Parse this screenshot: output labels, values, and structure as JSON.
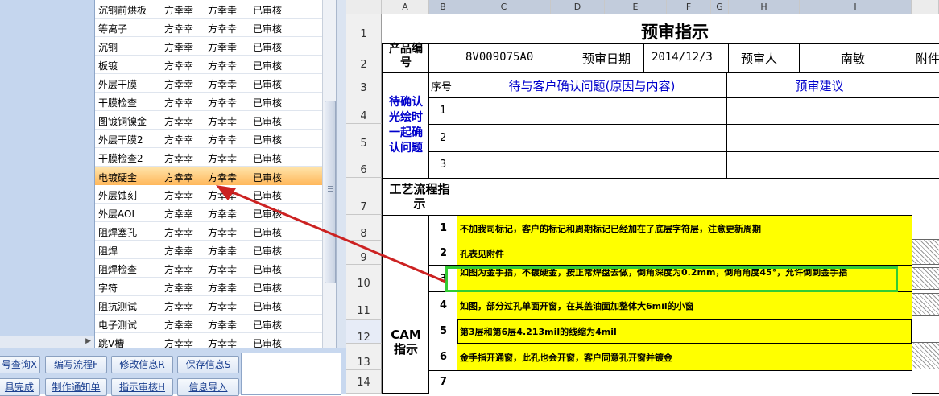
{
  "list": {
    "rows": [
      [
        "沉铜前烘板",
        "方幸幸",
        "方幸幸",
        "已审核"
      ],
      [
        "等离子",
        "方幸幸",
        "方幸幸",
        "已审核"
      ],
      [
        "沉铜",
        "方幸幸",
        "方幸幸",
        "已审核"
      ],
      [
        "板镀",
        "方幸幸",
        "方幸幸",
        "已审核"
      ],
      [
        "外层干膜",
        "方幸幸",
        "方幸幸",
        "已审核"
      ],
      [
        "干膜检查",
        "方幸幸",
        "方幸幸",
        "已审核"
      ],
      [
        "图镀铜镍金",
        "方幸幸",
        "方幸幸",
        "已审核"
      ],
      [
        "外层干膜2",
        "方幸幸",
        "方幸幸",
        "已审核"
      ],
      [
        "干膜检查2",
        "方幸幸",
        "方幸幸",
        "已审核"
      ],
      [
        "电镀硬金",
        "方幸幸",
        "方幸幸",
        "已审核"
      ],
      [
        "外层蚀刻",
        "方幸幸",
        "方幸幸",
        "已审核"
      ],
      [
        "外层AOI",
        "方幸幸",
        "方幸幸",
        "已审核"
      ],
      [
        "阻焊塞孔",
        "方幸幸",
        "方幸幸",
        "已审核"
      ],
      [
        "阻焊",
        "方幸幸",
        "方幸幸",
        "已审核"
      ],
      [
        "阻焊检查",
        "方幸幸",
        "方幸幸",
        "已审核"
      ],
      [
        "字符",
        "方幸幸",
        "方幸幸",
        "已审核"
      ],
      [
        "阻抗测试",
        "方幸幸",
        "方幸幸",
        "已审核"
      ],
      [
        "电子测试",
        "方幸幸",
        "方幸幸",
        "已审核"
      ],
      [
        "跳V槽",
        "方幸幸",
        "方幸幸",
        "已审核"
      ]
    ],
    "selected_index": 9
  },
  "buttons": {
    "query": "号查询X",
    "write_flow": "编写流程F",
    "modify_info": "修改信息R",
    "save_info": "保存信息S",
    "complete": "具完成",
    "make_notice": "制作通知单",
    "instruction_review": "指示审核H",
    "import_info": "信息导入"
  },
  "sheet": {
    "col_headers": [
      "A",
      "B",
      "C",
      "D",
      "E",
      "F",
      "G",
      "H",
      "I"
    ],
    "row_headers": [
      "1",
      "2",
      "3",
      "4",
      "5",
      "6",
      "7",
      "8",
      "9",
      "10",
      "11",
      "12",
      "13",
      "14"
    ],
    "selected_row": "12",
    "title": "预审指示",
    "product_no_label": "产品编号",
    "product_no": "8V009075A0",
    "review_date_label": "预审日期",
    "review_date": "2014/12/3",
    "reviewer_label": "预审人",
    "reviewer": "南敏",
    "attachment_label": "附件",
    "seq_label": "序号",
    "issues_label": "待与客户确认问题(原因与内容)",
    "suggestion_label": "预审建议",
    "confirm_label": "待确认光绘时一起确认问题",
    "confirm_seq": [
      "1",
      "2",
      "3"
    ],
    "process_label": "工艺流程指示",
    "cam_label": "CAM指示",
    "cam_items": [
      {
        "no": "1",
        "text": "不加我司标记，客户的标记和周期标记已经加在了底层字符层，注意更新周期"
      },
      {
        "no": "2",
        "text": "孔表见附件"
      },
      {
        "no": "3",
        "text": "如图为金手指，不镀硬金，按正常焊盘去做，倒角深度为0.2mm，倒角角度45°，允许倒到金手指"
      },
      {
        "no": "4",
        "text": "如图，部分过孔单面开窗，在其盖油面加整体大6mil的小窗"
      },
      {
        "no": "5",
        "text": "第3层和第6层4.213mil的线缩为4mil"
      },
      {
        "no": "6",
        "text": "金手指开通窗，此孔也会开窗，客户同意孔开窗并镀金"
      },
      {
        "no": "7",
        "text": ""
      }
    ]
  },
  "colors": {
    "highlight_box": "#33cc33",
    "arrow": "#cc2222",
    "cell_fill": "#ffff00",
    "selected_row": "#ffb75a"
  }
}
